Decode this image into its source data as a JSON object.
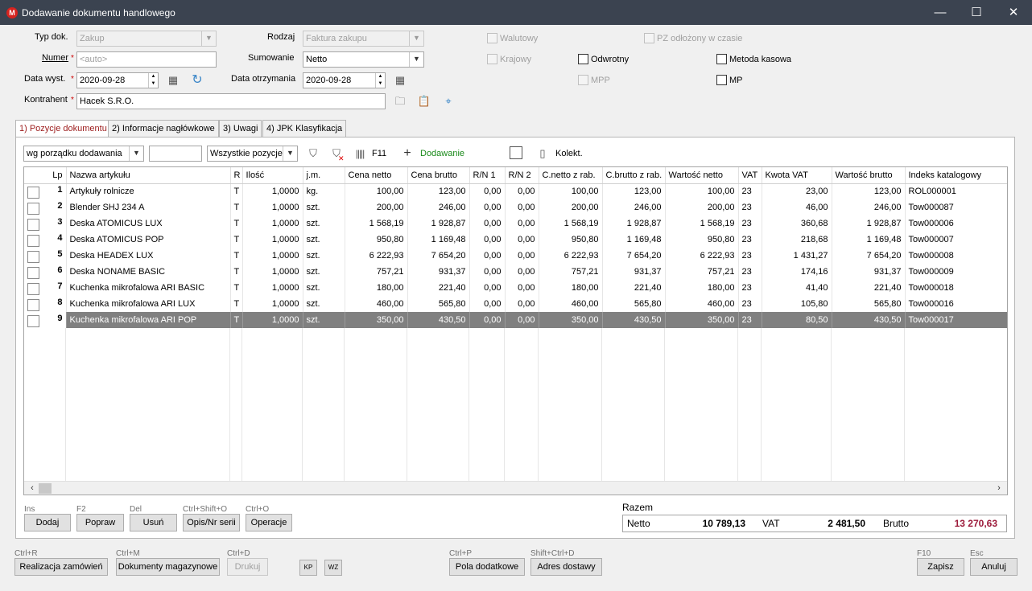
{
  "window": {
    "title": "Dodawanie dokumentu handlowego",
    "minimize": "—",
    "maximize": "☐",
    "close": "✕"
  },
  "form": {
    "typ_dok_label": "Typ dok.",
    "typ_dok_value": "Zakup",
    "rodzaj_label": "Rodzaj",
    "rodzaj_value": "Faktura zakupu",
    "numer_label": "Numer",
    "numer_value": "<auto>",
    "sumowanie_label": "Sumowanie",
    "sumowanie_value": "Netto",
    "data_wyst_label": "Data wyst.",
    "data_wyst_value": "2020-09-28",
    "data_otrz_label": "Data otrzymania",
    "data_otrz_value": "2020-09-28",
    "kontrahent_label": "Kontrahent",
    "kontrahent_value": "Hacek S.R.O.",
    "required_mark": "*",
    "walutowy": "Walutowy",
    "krajowy": "Krajowy",
    "mpp": "MPP",
    "odwrotny": "Odwrotny",
    "mp": "MP",
    "metoda_kasowa": "Metoda kasowa",
    "pz_odlozony": "PZ odłożony w czasie"
  },
  "tabs": [
    {
      "label": "1) Pozycje dokumentu"
    },
    {
      "label": "2) Informacje nagłówkowe"
    },
    {
      "label": "3) Uwagi"
    },
    {
      "label": "4) JPK Klasyfikacja"
    }
  ],
  "toolbar": {
    "sort_value": "wg porządku dodawania",
    "search_value": "",
    "filter_value": "Wszystkie pozycje",
    "f11_label": "F11",
    "add_label": "Dodawanie",
    "kolekt_label": "Kolekt."
  },
  "grid": {
    "columns": [
      "Lp",
      "Nazwa artykułu",
      "R",
      "Ilość",
      "j.m.",
      "Cena netto",
      "Cena brutto",
      "R/N 1",
      "R/N 2",
      "C.netto z rab.",
      "C.brutto z rab.",
      "Wartość netto",
      "VAT",
      "Kwota VAT",
      "Wartość brutto",
      "Indeks katalogowy"
    ],
    "rows": [
      [
        "1",
        "Artykuły rolnicze",
        "T",
        "1,0000",
        "kg.",
        "100,00",
        "123,00",
        "0,00",
        "0,00",
        "100,00",
        "123,00",
        "100,00",
        "23",
        "23,00",
        "123,00",
        "ROL000001"
      ],
      [
        "2",
        "Blender SHJ 234 A",
        "T",
        "1,0000",
        "szt.",
        "200,00",
        "246,00",
        "0,00",
        "0,00",
        "200,00",
        "246,00",
        "200,00",
        "23",
        "46,00",
        "246,00",
        "Tow000087"
      ],
      [
        "3",
        "Deska ATOMICUS LUX",
        "T",
        "1,0000",
        "szt.",
        "1 568,19",
        "1 928,87",
        "0,00",
        "0,00",
        "1 568,19",
        "1 928,87",
        "1 568,19",
        "23",
        "360,68",
        "1 928,87",
        "Tow000006"
      ],
      [
        "4",
        "Deska ATOMICUS POP",
        "T",
        "1,0000",
        "szt.",
        "950,80",
        "1 169,48",
        "0,00",
        "0,00",
        "950,80",
        "1 169,48",
        "950,80",
        "23",
        "218,68",
        "1 169,48",
        "Tow000007"
      ],
      [
        "5",
        "Deska HEADEX LUX",
        "T",
        "1,0000",
        "szt.",
        "6 222,93",
        "7 654,20",
        "0,00",
        "0,00",
        "6 222,93",
        "7 654,20",
        "6 222,93",
        "23",
        "1 431,27",
        "7 654,20",
        "Tow000008"
      ],
      [
        "6",
        "Deska NONAME BASIC",
        "T",
        "1,0000",
        "szt.",
        "757,21",
        "931,37",
        "0,00",
        "0,00",
        "757,21",
        "931,37",
        "757,21",
        "23",
        "174,16",
        "931,37",
        "Tow000009"
      ],
      [
        "7",
        "Kuchenka mikrofalowa ARI BASIC",
        "T",
        "1,0000",
        "szt.",
        "180,00",
        "221,40",
        "0,00",
        "0,00",
        "180,00",
        "221,40",
        "180,00",
        "23",
        "41,40",
        "221,40",
        "Tow000018"
      ],
      [
        "8",
        "Kuchenka mikrofalowa ARI LUX",
        "T",
        "1,0000",
        "szt.",
        "460,00",
        "565,80",
        "0,00",
        "0,00",
        "460,00",
        "565,80",
        "460,00",
        "23",
        "105,80",
        "565,80",
        "Tow000016"
      ],
      [
        "9",
        "Kuchenka mikrofalowa ARI POP",
        "T",
        "1,0000",
        "szt.",
        "350,00",
        "430,50",
        "0,00",
        "0,00",
        "350,00",
        "430,50",
        "350,00",
        "23",
        "80,50",
        "430,50",
        "Tow000017"
      ]
    ]
  },
  "actions": {
    "ins": "Ins",
    "dodaj": "Dodaj",
    "f2": "F2",
    "popraw": "Popraw",
    "del": "Del",
    "usun": "Usuń",
    "ctrl_shift_o": "Ctrl+Shift+O",
    "opis": "Opis/Nr serii",
    "ctrl_o": "Ctrl+O",
    "operacje": "Operacje"
  },
  "totals": {
    "razem": "Razem",
    "netto_label": "Netto",
    "netto_value": "10 789,13",
    "vat_label": "VAT",
    "vat_value": "2 481,50",
    "brutto_label": "Brutto",
    "brutto_value": "13 270,63"
  },
  "footer": {
    "ctrl_r": "Ctrl+R",
    "realizacja": "Realizacja zamówień",
    "ctrl_m": "Ctrl+M",
    "dokumenty": "Dokumenty magazynowe",
    "ctrl_d": "Ctrl+D",
    "drukuj": "Drukuj",
    "kp": "KP",
    "wz": "WZ",
    "ctrl_p": "Ctrl+P",
    "pola": "Pola dodatkowe",
    "shift_ctrl_d": "Shift+Ctrl+D",
    "adres": "Adres dostawy",
    "f10": "F10",
    "zapisz": "Zapisz",
    "esc": "Esc",
    "anuluj": "Anuluj"
  },
  "colors": {
    "titlebar": "#3b4350",
    "accent_red": "#9c1b1b",
    "selected_row": "#808080",
    "add_green": "#1a8a1a"
  }
}
